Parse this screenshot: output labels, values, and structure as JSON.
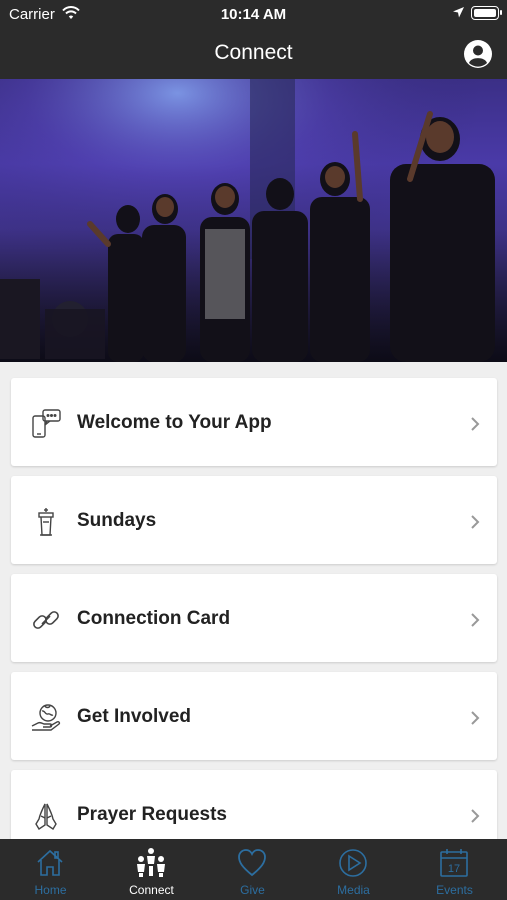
{
  "status_bar": {
    "carrier": "Carrier",
    "time": "10:14 AM"
  },
  "nav": {
    "title": "Connect"
  },
  "hero": {
    "icon": "worship-choir-photo"
  },
  "menu": {
    "items": [
      {
        "label": "Welcome to Your App",
        "icon": "phone-chat-icon"
      },
      {
        "label": "Sundays",
        "icon": "podium-icon"
      },
      {
        "label": "Connection Card",
        "icon": "link-icon"
      },
      {
        "label": "Get Involved",
        "icon": "hand-globe-icon"
      },
      {
        "label": "Prayer Requests",
        "icon": "praying-hands-icon"
      }
    ]
  },
  "tabs": [
    {
      "label": "Home",
      "icon": "house-icon",
      "active": false
    },
    {
      "label": "Connect",
      "icon": "people-icon",
      "active": true
    },
    {
      "label": "Give",
      "icon": "heart-icon",
      "active": false
    },
    {
      "label": "Media",
      "icon": "play-circle-icon",
      "active": false
    },
    {
      "label": "Events",
      "icon": "calendar-icon",
      "active": false
    }
  ],
  "colors": {
    "bar_background": "#2b2b2b",
    "inactive_tab": "#2c6ea0",
    "active_tab": "#ffffff",
    "page_background": "#efefef"
  }
}
